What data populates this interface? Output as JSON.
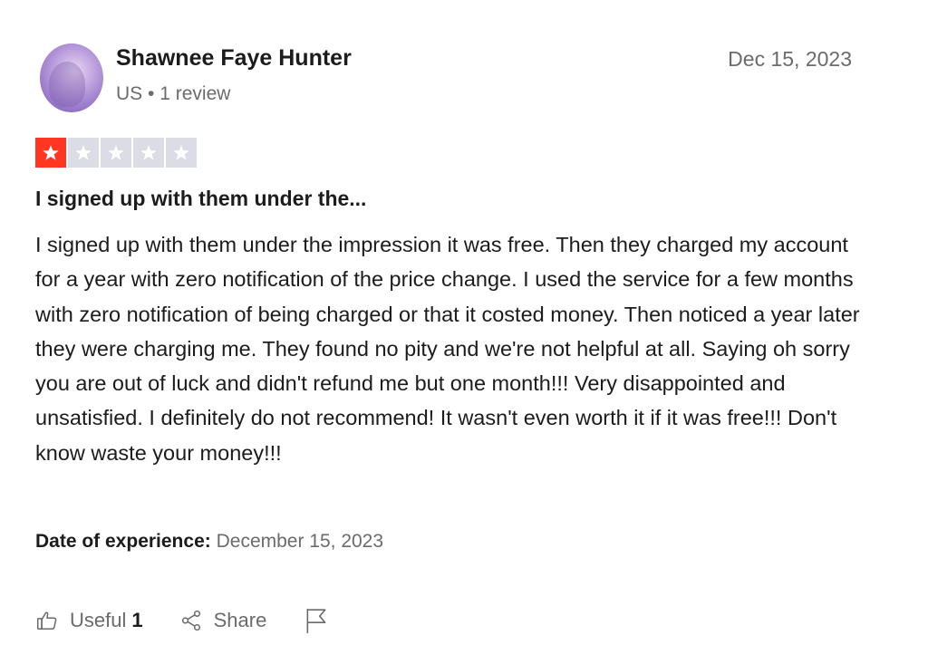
{
  "author": {
    "name": "Shawnee Faye Hunter",
    "country": "US",
    "review_count": "1 review",
    "separator": "•"
  },
  "review": {
    "date": "Dec 15, 2023",
    "rating": 1,
    "rating_max": 5,
    "title": "I signed up with them under the...",
    "body": "I signed up with them under the impression it was free. Then they charged my account for a year with zero notification of the price change. I used the service for a few months with zero notification of being charged or that it costed money. Then noticed a year later they were charging me. They found no pity and we're not helpful at all. Saying oh sorry you are out of luck and didn't refund me but one month!!! Very disappointed and unsatisfied. I definitely do not recommend! It wasn't even worth it if it was free!!! Don't know waste your money!!!",
    "experience_label": "Date of experience:",
    "experience_date": "December 15, 2023"
  },
  "actions": {
    "useful_label": "Useful",
    "useful_count": "1",
    "share_label": "Share"
  },
  "icons": {
    "useful": "thumbs-up-icon",
    "share": "share-icon",
    "report": "flag-icon",
    "star": "star-icon"
  },
  "colors": {
    "star_filled": "#ff3722",
    "star_empty": "#dcdce6",
    "text": "#1c1c1c",
    "muted": "#6b6b6b"
  }
}
